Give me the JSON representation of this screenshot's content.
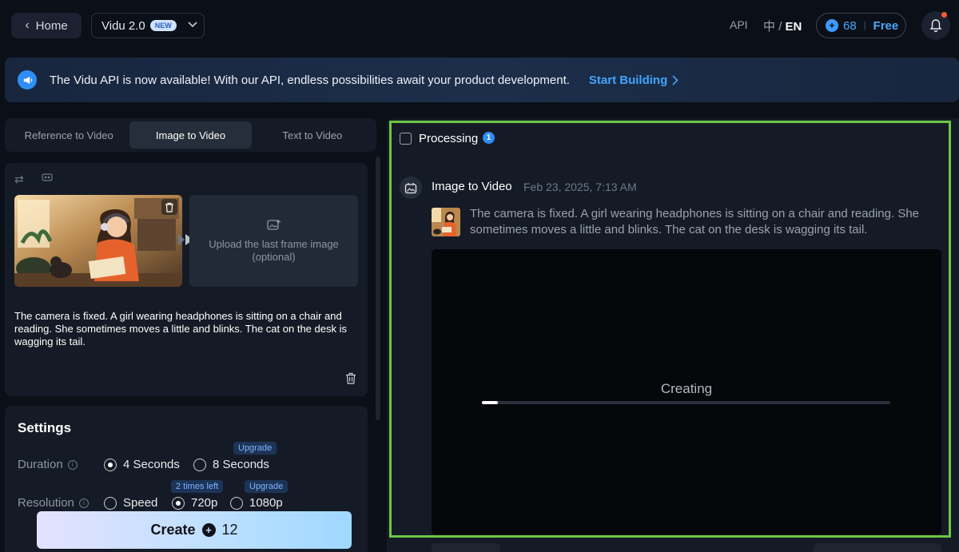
{
  "header": {
    "home_label": "Home",
    "model_name": "Vidu 2.0",
    "model_badge": "NEW",
    "api_label": "API",
    "lang_cn": "中",
    "lang_sep": "/",
    "lang_en": "EN",
    "credits": "68",
    "credits_sep": "|",
    "plan": "Free"
  },
  "banner": {
    "text": "The Vidu API is now available! With our API, endless possibilities await your product development.",
    "cta": "Start Building"
  },
  "tabs": [
    {
      "label": "Reference to Video",
      "active": false
    },
    {
      "label": "Image to Video",
      "active": true
    },
    {
      "label": "Text to Video",
      "active": false
    }
  ],
  "input": {
    "upload_label": "Upload the last frame image (optional)",
    "prompt": "The camera is fixed. A girl wearing headphones is sitting on a chair and reading. She sometimes moves a little and blinks. The cat on the desk is wagging its tail."
  },
  "settings": {
    "title": "Settings",
    "duration_label": "Duration",
    "duration_options": [
      "4 Seconds",
      "8 Seconds"
    ],
    "duration_selected": "4 Seconds",
    "duration_upgrade_tag": "Upgrade",
    "resolution_label": "Resolution",
    "resolution_options": [
      "Speed",
      "720p",
      "1080p"
    ],
    "resolution_selected": "720p",
    "resolution_720_tag": "2 times left",
    "resolution_1080_tag": "Upgrade"
  },
  "create": {
    "label": "Create",
    "cost": "12"
  },
  "results": {
    "processing_label": "Processing",
    "processing_count": "1",
    "task_title": "Image to Video",
    "task_time": "Feb 23, 2025, 7:13 AM",
    "task_prompt": "The camera is fixed. A girl wearing headphones is sitting on a chair and reading. She sometimes moves a little and blinks. The cat on the desk is wagging its tail.",
    "status": "Creating",
    "progress_percent": 4
  },
  "colors": {
    "accent": "#3fa5ff",
    "highlight_border": "#6cc644",
    "background": "#0b0f17"
  }
}
